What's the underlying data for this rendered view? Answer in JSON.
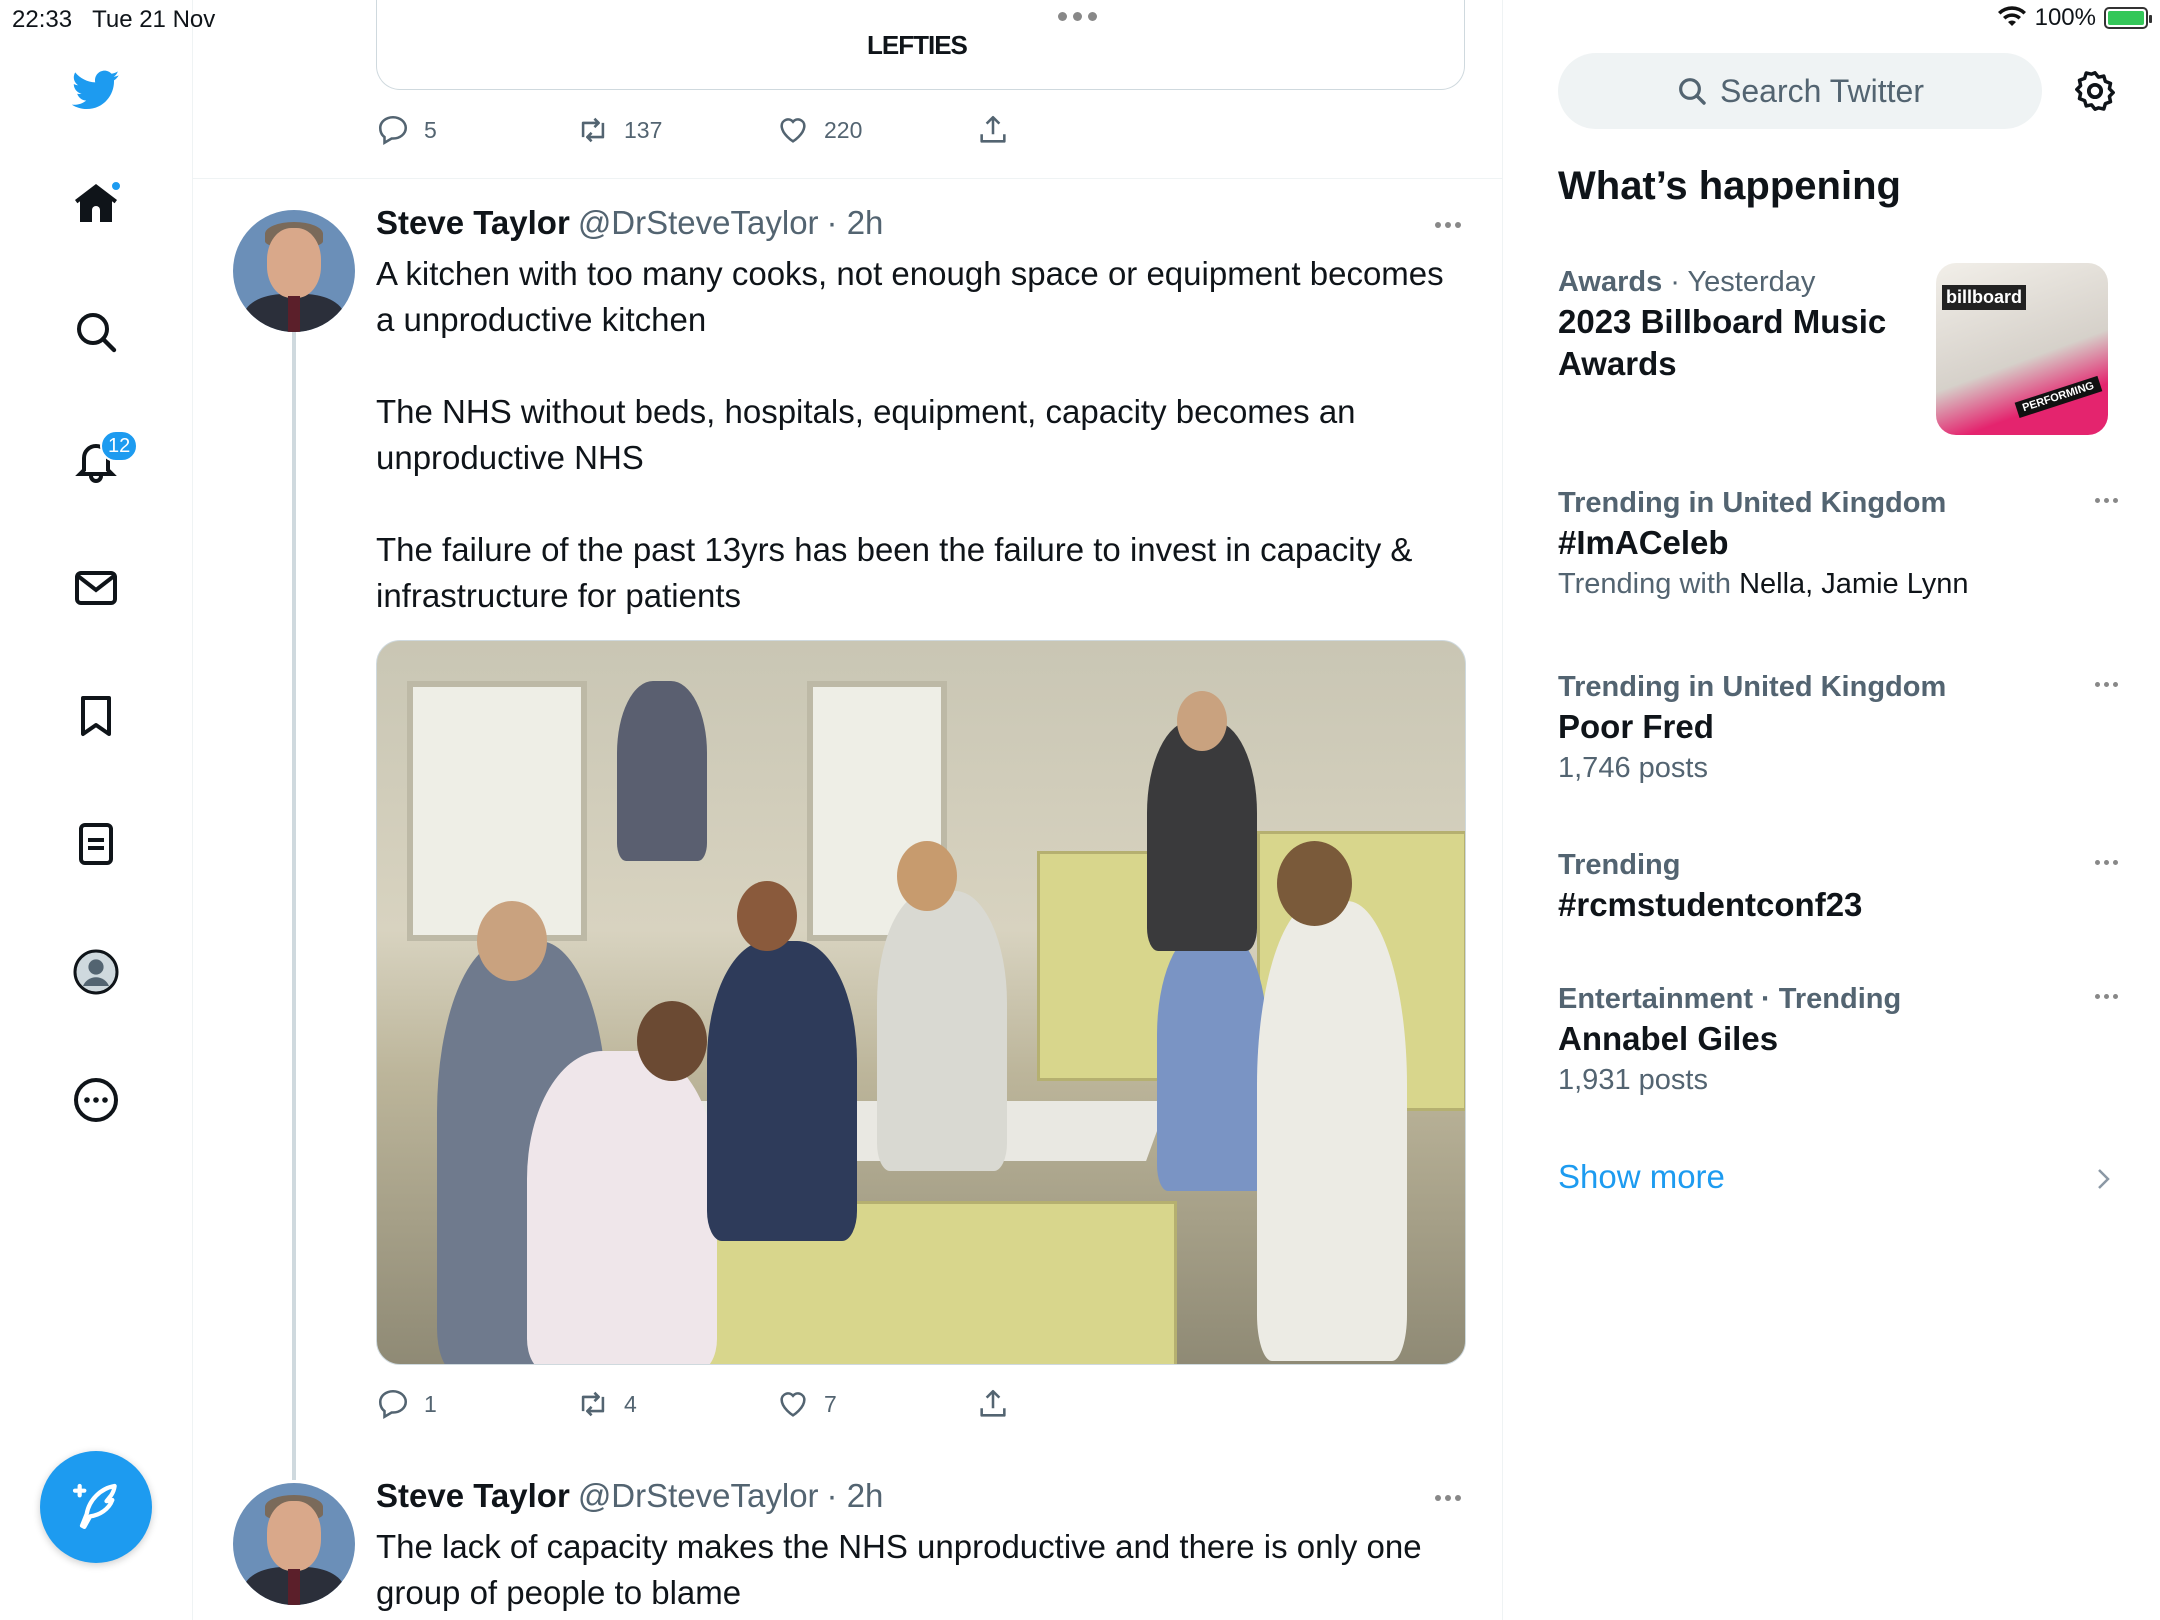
{
  "status_bar": {
    "time": "22:33",
    "date": "Tue 21 Nov",
    "battery": "100%"
  },
  "nav": {
    "notifications_count": "12",
    "icons": [
      "twitter-logo-icon",
      "home-icon",
      "search-icon",
      "bell-icon",
      "mail-icon",
      "bookmark-icon",
      "lists-icon",
      "profile-icon",
      "more-icon",
      "compose-icon"
    ]
  },
  "previous_tweet": {
    "card_caption": "LEFTIES",
    "replies": "5",
    "retweets": "137",
    "likes": "220"
  },
  "tweets": [
    {
      "name": "Steve Taylor",
      "handle": "@DrSteveTaylor",
      "time": "· 2h",
      "paragraphs": [
        "A kitchen with too many cooks, not enough space or equipment becomes a unproductive kitchen",
        "The NHS without beds, hospitals, equipment, capacity becomes an unproductive NHS",
        "The failure of the past 13yrs has been the failure to invest in capacity & infrastructure for patients"
      ],
      "replies": "1",
      "retweets": "4",
      "likes": "7"
    },
    {
      "name": "Steve Taylor",
      "handle": "@DrSteveTaylor",
      "time": "· 2h",
      "text": "The lack of capacity makes the NHS unproductive and there is only one group of people to blame"
    }
  ],
  "sidebar": {
    "search_placeholder": "Search Twitter",
    "section_title": "What’s happening",
    "trends": [
      {
        "meta_category": "Awards",
        "meta_extra": " · Yesterday",
        "title": "2023 Billboard Music Awards",
        "thumb_label": "billboard",
        "thumb_badge": "PERFORMING"
      },
      {
        "meta": "Trending in United Kingdom",
        "title": "#ImACeleb",
        "sub_prefix": "Trending with ",
        "sub_names": "Nella, Jamie Lynn"
      },
      {
        "meta": "Trending in United Kingdom",
        "title": "Poor Fred",
        "sub": "1,746 posts"
      },
      {
        "meta": "Trending",
        "title": "#rcmstudentconf23"
      },
      {
        "meta": "Entertainment · Trending",
        "title": "Annabel Giles",
        "sub": "1,931 posts"
      }
    ],
    "show_more": "Show more"
  },
  "colors": {
    "accent": "#1d9bf0",
    "text_primary": "#0f1419",
    "text_secondary": "#536471"
  }
}
